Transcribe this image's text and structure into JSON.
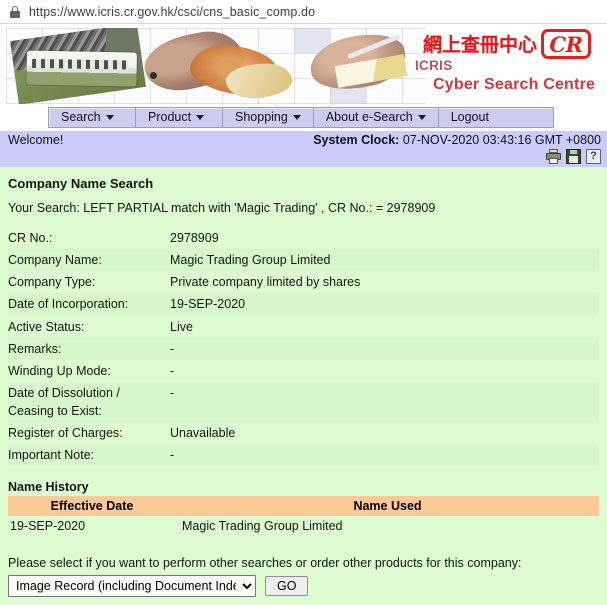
{
  "browser": {
    "url": "https://www.icris.cr.gov.hk/csci/cns_basic_comp.do",
    "lock_icon": "lock-icon"
  },
  "banner": {
    "logo_chinese": "網上查冊中心",
    "logo_cr": "CR",
    "logo_icris": "ICRIS",
    "logo_subtitle": "Cyber Search Centre"
  },
  "nav": {
    "items": [
      {
        "label": "Search",
        "has_caret": true
      },
      {
        "label": "Product",
        "has_caret": true
      },
      {
        "label": "Shopping",
        "has_caret": true
      },
      {
        "label": "About e-Search",
        "has_caret": true
      },
      {
        "label": "Logout",
        "has_caret": false
      }
    ]
  },
  "statusbar": {
    "welcome": "Welcome!",
    "clock_label": "System Clock:",
    "clock_value": "07-NOV-2020 03:43:16 GMT +0800",
    "icons": [
      "print-icon",
      "save-icon",
      "help-icon"
    ]
  },
  "main": {
    "page_title": "Company Name Search",
    "your_search": "Your Search: LEFT PARTIAL match with 'Magic Trading' , CR No.: = 2978909",
    "details": [
      {
        "label": "CR No.:",
        "value": "2978909"
      },
      {
        "label": "Company Name:",
        "value": "Magic Trading Group Limited"
      },
      {
        "label": "Company Type:",
        "value": "Private company limited by shares"
      },
      {
        "label": "Date of Incorporation:",
        "value": "19-SEP-2020"
      },
      {
        "label": "Active Status:",
        "value": "Live"
      },
      {
        "label": "Remarks:",
        "value": "-"
      },
      {
        "label": "Winding Up Mode:",
        "value": "-"
      },
      {
        "label": "Date of Dissolution / Ceasing to Exist:",
        "value": "-"
      },
      {
        "label": "Register of Charges:",
        "value": "Unavailable"
      },
      {
        "label": "Important Note:",
        "value": "-"
      }
    ],
    "name_history": {
      "section_title": "Name History",
      "columns": [
        "Effective Date",
        "Name Used"
      ],
      "rows": [
        {
          "effective_date": "19-SEP-2020",
          "name_used": "Magic Trading Group Limited"
        }
      ]
    },
    "prompt": {
      "text": "Please select if you want to perform other searches or order other products for this company:",
      "selected_option": "Image Record (including Document Index)",
      "options": [
        "Image Record (including Document Index)"
      ],
      "go_label": "GO"
    }
  },
  "colors": {
    "nav_bg": "#ccccf0",
    "status_bg": "#ccccfa",
    "content_bg": "#ddfcd2",
    "content_bg_alt": "#d7f8cb",
    "table_header_orange": "#fcca96",
    "logo_red": "#e2181c"
  }
}
